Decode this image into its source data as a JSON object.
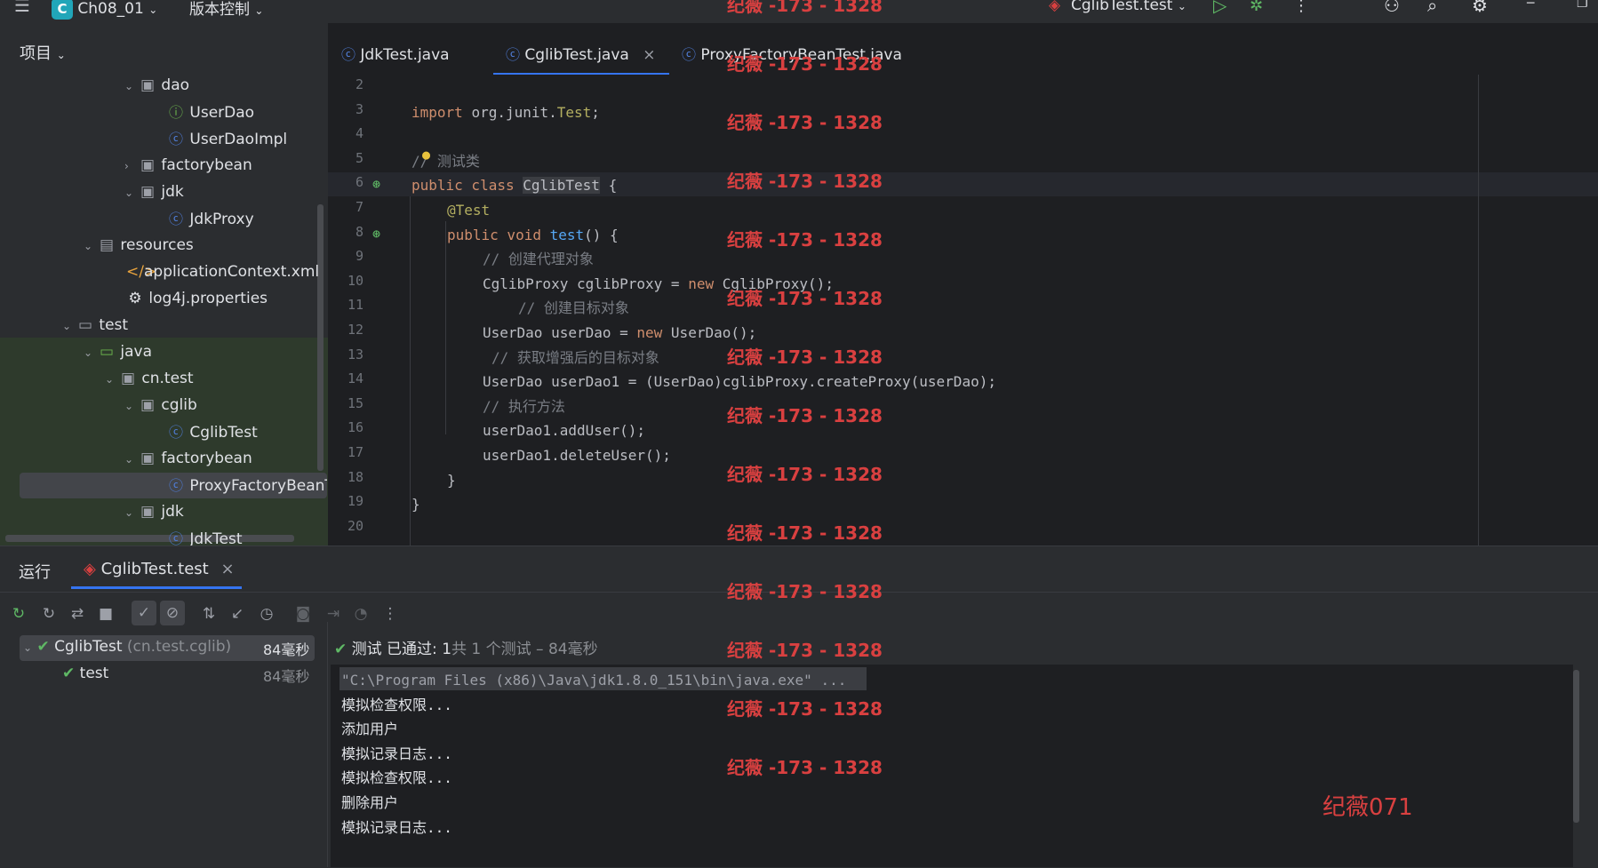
{
  "titlebar": {
    "project_badge": "C",
    "project_name": "Ch08_01",
    "vcs": "版本控制",
    "run_config": "CglibTest.test",
    "watermark": "纪薇 -173 - 1328"
  },
  "project_panel": {
    "title": "项目",
    "tree": [
      {
        "label": "dao",
        "kind": "folder",
        "open": true
      },
      {
        "label": "UserDao",
        "kind": "interface"
      },
      {
        "label": "UserDaoImpl",
        "kind": "class"
      },
      {
        "label": "factorybean",
        "kind": "folder",
        "open": false
      },
      {
        "label": "jdk",
        "kind": "folder",
        "open": true
      },
      {
        "label": "JdkProxy",
        "kind": "class"
      },
      {
        "label": "resources",
        "kind": "folder",
        "open": true
      },
      {
        "label": "applicationContext.xml",
        "kind": "xml"
      },
      {
        "label": "log4j.properties",
        "kind": "props"
      },
      {
        "label": "test",
        "kind": "folder",
        "open": true
      },
      {
        "label": "java",
        "kind": "folder",
        "open": true
      },
      {
        "label": "cn.test",
        "kind": "folder",
        "open": true
      },
      {
        "label": "cglib",
        "kind": "folder",
        "open": true
      },
      {
        "label": "CglibTest",
        "kind": "class"
      },
      {
        "label": "factorybean",
        "kind": "folder",
        "open": true
      },
      {
        "label": "ProxyFactoryBeanT",
        "kind": "class"
      },
      {
        "label": "jdk",
        "kind": "folder",
        "open": true
      },
      {
        "label": "JdkTest",
        "kind": "class"
      }
    ]
  },
  "tabs": [
    {
      "label": "JdkTest.java"
    },
    {
      "label": "CglibTest.java",
      "close": "×"
    },
    {
      "label": "ProxyFactoryBeanTest.java"
    }
  ],
  "editor": {
    "line_numbers": [
      "2",
      "3",
      "4",
      "5",
      "6",
      "7",
      "8",
      "9",
      "10",
      "11",
      "12",
      "13",
      "14",
      "15",
      "16",
      "17",
      "18",
      "19",
      "20"
    ],
    "lines": {
      "l3_kw": "import ",
      "l3_rest": "org.junit.",
      "l3_cls": "Test",
      "l3_end": ";",
      "l5": "// 测试类",
      "l6_kw": "public class ",
      "l6_cls": "CglibTest",
      "l6_end": " {",
      "l7": "@Test",
      "l8_kw": "public void ",
      "l8_fn": "test",
      "l8_end": "() {",
      "l9": "// 创建代理对象",
      "l10_a": "CglibProxy cglibProxy = ",
      "l10_kw": "new ",
      "l10_b": "CglibProxy();",
      "l11": "// 创建目标对象",
      "l12_a": "UserDao userDao = ",
      "l12_kw": "new ",
      "l12_b": "UserDao();",
      "l13": "// 获取增强后的目标对象",
      "l14": "UserDao userDao1 = (UserDao)cglibProxy.createProxy(userDao);",
      "l15": "// 执行方法",
      "l16": "userDao1.addUser();",
      "l17": "userDao1.deleteUser();",
      "l18": "}",
      "l19": "}"
    }
  },
  "run_panel": {
    "title": "运行",
    "tab": "CglibTest.test",
    "tab_close": "×",
    "tree_root": "CglibTest",
    "tree_root_pkg": "(cn.test.cglib)",
    "tree_root_time": "84毫秒",
    "tree_child": "test",
    "tree_child_time": "84毫秒",
    "status_prefix": "测试 已通过: ",
    "status_count": "1",
    "status_suffix": "共 1 个测试 – 84毫秒",
    "console": [
      "\"C:\\Program Files (x86)\\Java\\jdk1.8.0_151\\bin\\java.exe\" ...",
      "模拟检查权限...",
      "添加用户",
      "模拟记录日志...",
      "模拟检查权限...",
      "删除用户",
      "模拟记录日志..."
    ],
    "watermark2": "纪薇071"
  }
}
